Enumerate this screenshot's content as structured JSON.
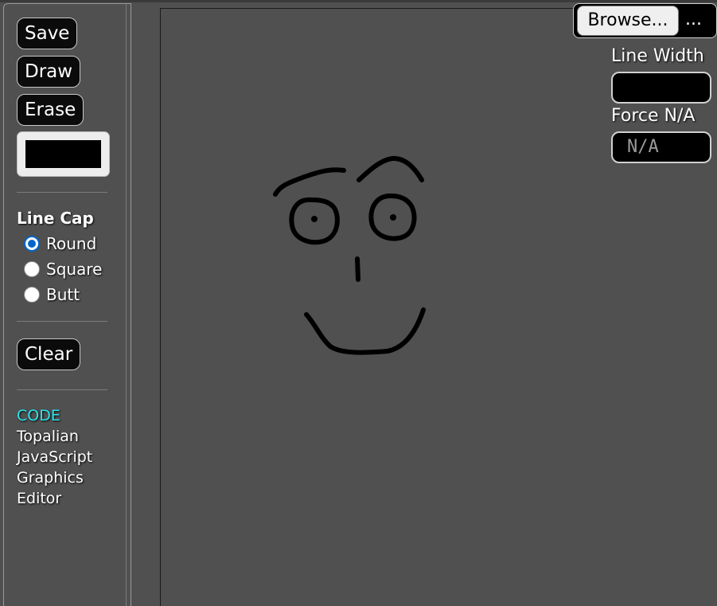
{
  "sidebar": {
    "save_label": "Save",
    "draw_label": "Draw",
    "erase_label": "Erase",
    "stroke_color": "#000000",
    "line_cap_title": "Line Cap",
    "line_cap_options": [
      "Round",
      "Square",
      "Butt"
    ],
    "line_cap_selected": "Round",
    "clear_label": "Clear",
    "credits": {
      "code_label": "CODE",
      "lines": [
        "Topalian",
        "JavaScript",
        "Graphics",
        "Editor"
      ]
    }
  },
  "controls": {
    "browse_label": "Browse...",
    "file_name": "...",
    "line_width_label": "Line Width",
    "line_width_value": "",
    "force_label": "Force N/A",
    "force_placeholder": "N/A"
  },
  "colors": {
    "background": "#505050",
    "accent_code": "#29e6ee",
    "radio_selected": "#0066cc"
  }
}
